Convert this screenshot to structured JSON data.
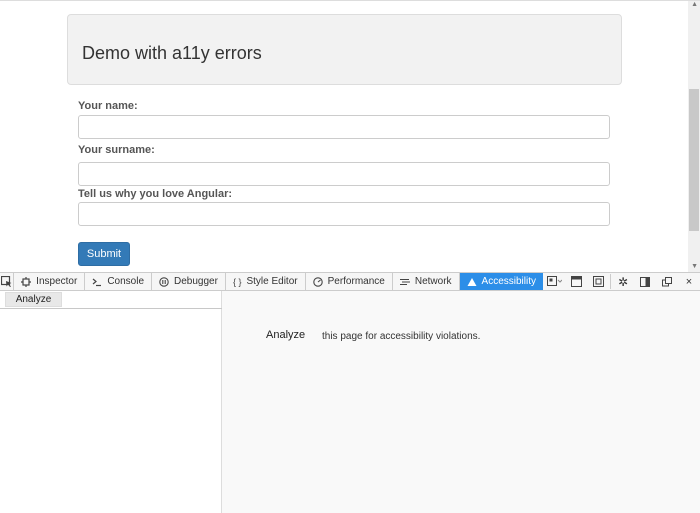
{
  "page": {
    "heading": "Demo with a11y errors",
    "fields": [
      {
        "label": "Your name:",
        "value": ""
      },
      {
        "label": "Your surname:",
        "value": ""
      },
      {
        "label": "Tell us why you love Angular:",
        "value": ""
      }
    ],
    "submit_label": "Submit"
  },
  "devtools": {
    "tabs": [
      {
        "label": "Inspector",
        "icon": "inspector-icon"
      },
      {
        "label": "Console",
        "icon": "console-icon"
      },
      {
        "label": "Debugger",
        "icon": "debugger-icon"
      },
      {
        "label": "Style Editor",
        "icon": "style-editor-icon"
      },
      {
        "label": "Performance",
        "icon": "performance-icon"
      },
      {
        "label": "Network",
        "icon": "network-icon"
      },
      {
        "label": "Accessibility",
        "icon": "accessibility-icon",
        "active": true
      }
    ],
    "accent_color": "#2c8ee8",
    "left_button": "Analyze",
    "empty_action": "Analyze",
    "empty_text": "this page for accessibility violations."
  }
}
